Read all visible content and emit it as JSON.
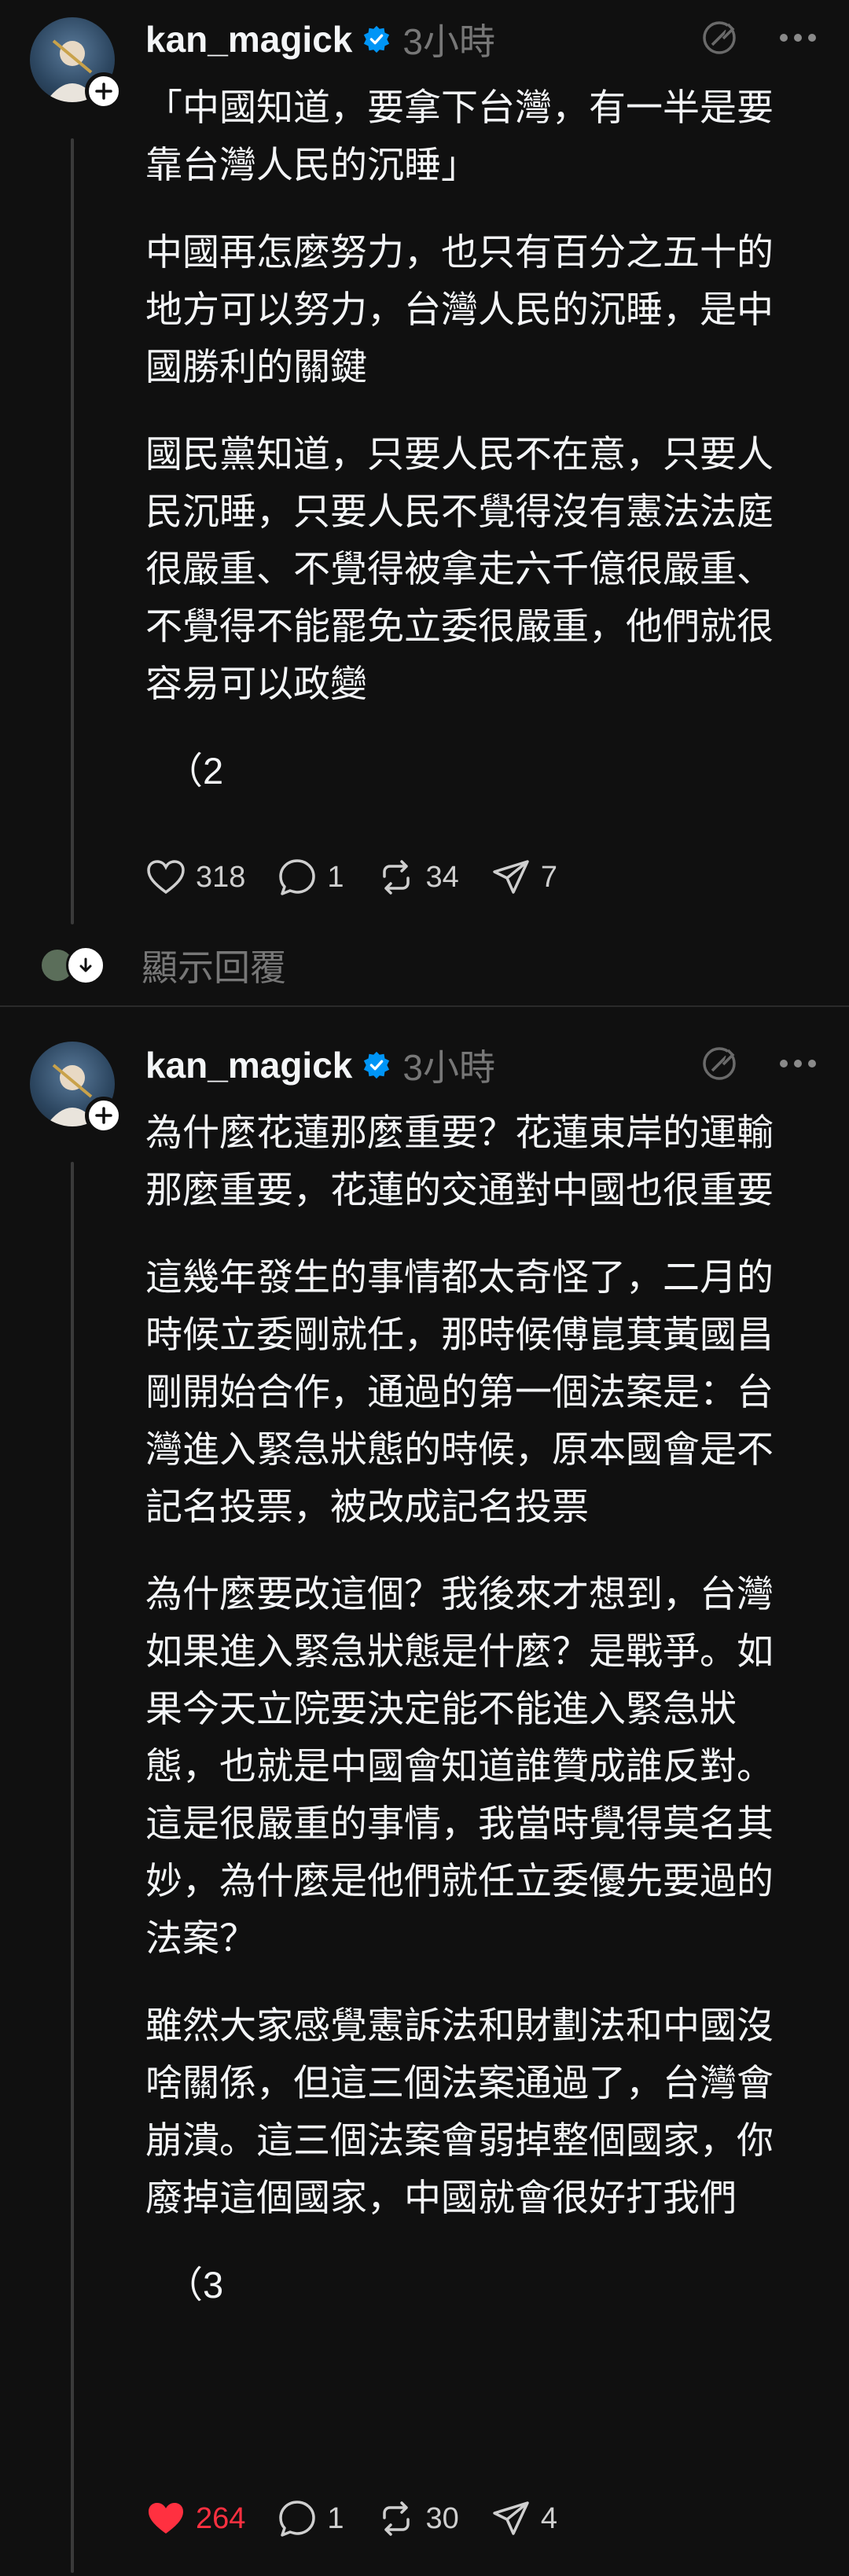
{
  "colors": {
    "background": "#101010",
    "text": "#f3f5f7",
    "muted": "#777777",
    "like_active": "#ff3040",
    "verified": "#0095f6"
  },
  "posts": [
    {
      "username": "kan_magick",
      "time": "3小時",
      "paragraphs": [
        "「中國知道，要拿下台灣，有一半是要靠台灣人民的沉睡」",
        "中國再怎麼努力，也只有百分之五十的地方可以努力，台灣人民的沉睡，是中國勝利的關鍵",
        "國民黨知道，只要人民不在意，只要人民沉睡，只要人民不覺得沒有憲法法庭很嚴重、不覺得被拿走六千億很嚴重、不覺得不能罷免立委很嚴重，他們就很容易可以政變"
      ],
      "part": "（2",
      "likes": "318",
      "liked": false,
      "replies": "1",
      "reposts": "34",
      "shares": "7"
    },
    {
      "username": "kan_magick",
      "time": "3小時",
      "paragraphs": [
        "為什麼花蓮那麼重要？花蓮東岸的運輸那麼重要，花蓮的交通對中國也很重要",
        "這幾年發生的事情都太奇怪了，二月的時候立委剛就任，那時候傅崑萁黃國昌剛開始合作，通過的第一個法案是：台灣進入緊急狀態的時候，原本國會是不記名投票，被改成記名投票",
        "為什麼要改這個？我後來才想到，台灣如果進入緊急狀態是什麼？是戰爭。如果今天立院要決定能不能進入緊急狀態，也就是中國會知道誰贊成誰反對。這是很嚴重的事情，我當時覺得莫名其妙，為什麼是他們就任立委優先要過的法案？",
        "雖然大家感覺憲訴法和財劃法和中國沒啥關係，但這三個法案通過了，台灣會崩潰。這三個法案會弱掉整個國家，你廢掉這個國家，中國就會很好打我們"
      ],
      "part": "（3",
      "likes": "264",
      "liked": true,
      "replies": "1",
      "reposts": "30",
      "shares": "4"
    }
  ],
  "show_replies_label": "顯示回覆",
  "icons": [
    "plus-icon",
    "verified-badge-icon",
    "translate-icon",
    "more-icon",
    "heart-icon",
    "comment-icon",
    "repost-icon",
    "share-icon",
    "chevron-down-icon"
  ]
}
